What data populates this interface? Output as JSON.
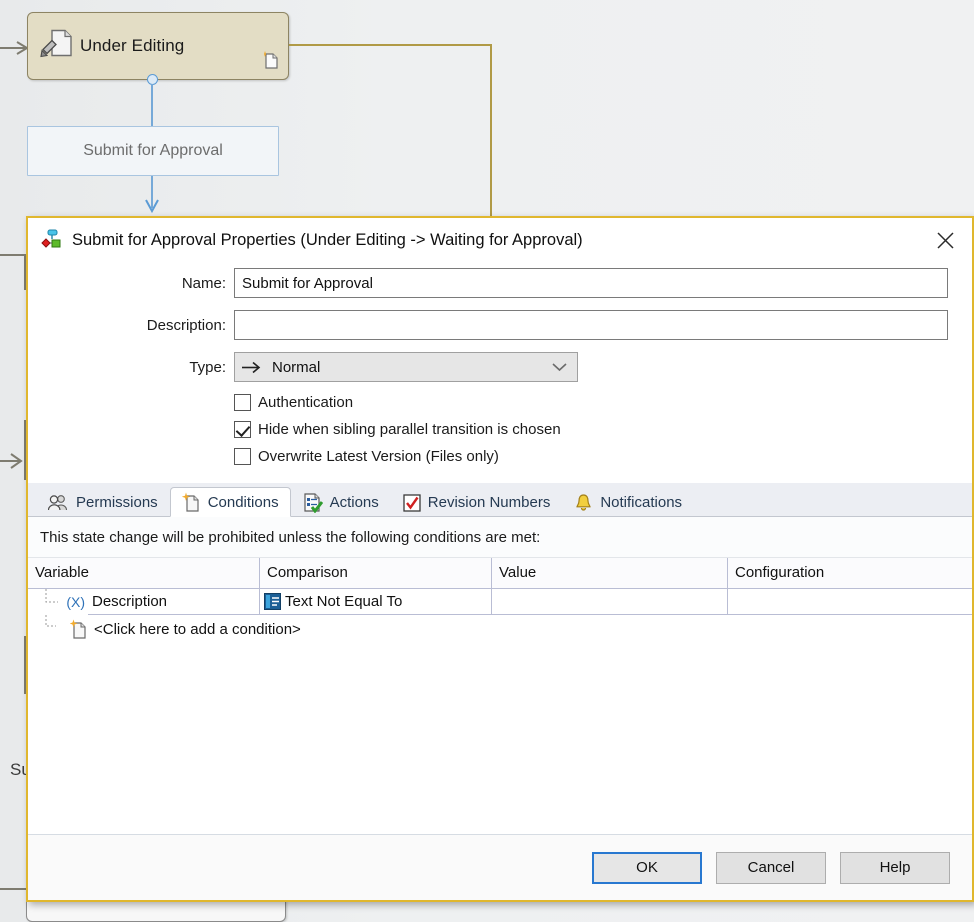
{
  "background": {
    "state": {
      "label": "Under Editing",
      "icon": "under-editing-state-icon",
      "corner_icon": "new-document-icon"
    },
    "transition": {
      "label": "Submit for Approval"
    },
    "partial_text": "Su"
  },
  "dialog": {
    "icon": "workflow-transition-icon",
    "title": "Submit for Approval Properties (Under Editing -> Waiting for Approval)",
    "close_icon": "close-icon",
    "fields": {
      "name_label": "Name:",
      "name_value": "Submit for Approval",
      "name_placeholder": "",
      "description_label": "Description:",
      "description_value": "",
      "description_placeholder": "",
      "type_label": "Type:",
      "type_value": "Normal",
      "type_icon": "arrow-right-icon",
      "type_caret_icon": "chevron-down-icon"
    },
    "checkboxes": [
      {
        "label": "Authentication",
        "checked": false
      },
      {
        "label": "Hide when sibling parallel transition is chosen",
        "checked": true
      },
      {
        "label": "Overwrite Latest Version (Files only)",
        "checked": false
      }
    ],
    "tabs": [
      {
        "label": "Permissions",
        "icon": "users-icon",
        "active": false
      },
      {
        "label": "Conditions",
        "icon": "condition-document-icon",
        "active": true
      },
      {
        "label": "Actions",
        "icon": "actions-checklist-icon",
        "active": false
      },
      {
        "label": "Revision Numbers",
        "icon": "red-check-box-icon",
        "active": false
      },
      {
        "label": "Notifications",
        "icon": "bell-icon",
        "active": false
      }
    ],
    "conditions_panel": {
      "note": "This state change will be prohibited unless the following conditions are met:",
      "columns": [
        "Variable",
        "Comparison",
        "Value",
        "Configuration"
      ],
      "rows": [
        {
          "gutter_icon": "variable-x-icon",
          "gutter_label": "(X)",
          "variable": "Description",
          "comparison": "Text Not Equal To",
          "comparison_icon": "text-comparison-icon",
          "value": "",
          "configuration": ""
        }
      ],
      "add_row": {
        "icon": "new-condition-icon",
        "label": "<Click here to add a condition>"
      }
    },
    "buttons": [
      {
        "label": "OK",
        "default": true
      },
      {
        "label": "Cancel",
        "default": false
      },
      {
        "label": "Help",
        "default": false
      }
    ]
  },
  "colors": {
    "dialog_border": "#e0b72e",
    "state_fill": "#e3ddc5",
    "state_border": "#8d8463",
    "transition_border": "#a9c5e0",
    "flow_blue": "#76a9d8",
    "flow_gold": "#b09a46",
    "default_button_border": "#2878d0"
  }
}
